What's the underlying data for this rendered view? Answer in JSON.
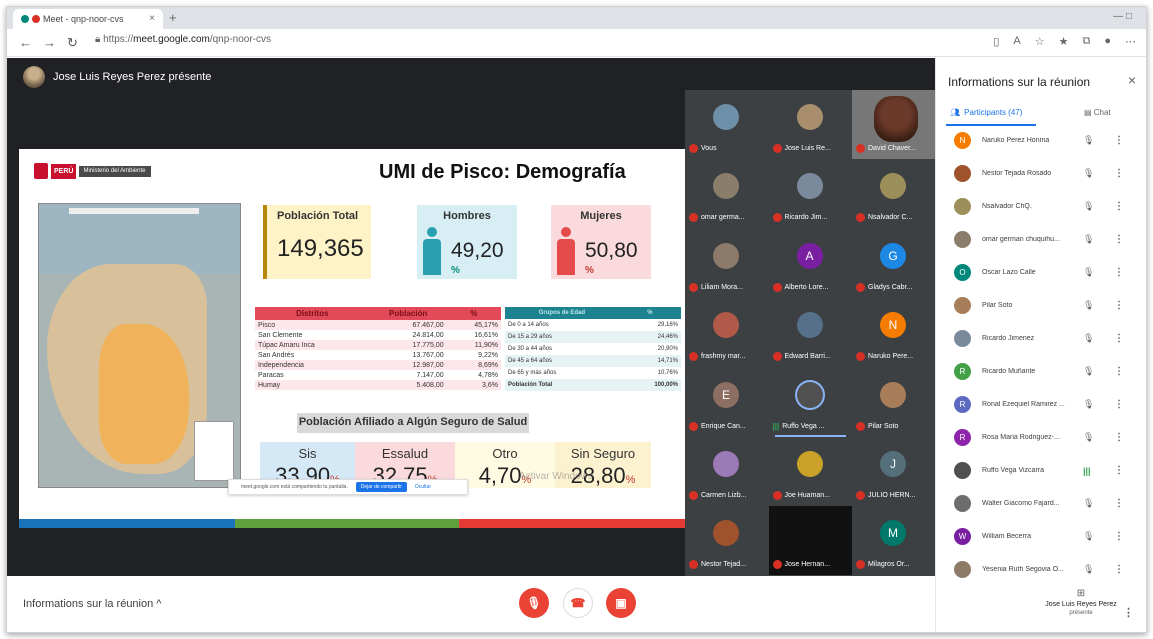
{
  "browser": {
    "tab_title": "Meet - qnp-noor-cvs",
    "tab_close": "×",
    "new_tab": "+",
    "window_controls": "—  □",
    "back": "←",
    "forward": "→",
    "reload": "↻",
    "url_prefix": "https://",
    "url_host": "meet.google.com",
    "url_path": "/qnp-noor-cvs"
  },
  "meet": {
    "presenter_label": "Jose Luis Reyes Perez présente",
    "bottom_info": "Informations sur la réunion ^",
    "controls": {
      "mic": "mic-off",
      "end": "hang-up",
      "cam": "camera-off"
    }
  },
  "slide": {
    "logo_country": "PERÚ",
    "logo_ministry": "Ministerio del Ambiente",
    "title": "UMI de Pisco: Demografía",
    "kpis": {
      "total_label": "Población Total",
      "total_value": "149,365",
      "men_label": "Hombres",
      "men_value": "49,20",
      "men_unit": "%",
      "women_label": "Mujeres",
      "women_value": "50,80",
      "women_unit": "%"
    },
    "districts": {
      "headers": [
        "Distritos",
        "Población",
        "%"
      ],
      "rows": [
        [
          "Pisco",
          "67.467,00",
          "45,17%"
        ],
        [
          "San Clemente",
          "24.814,00",
          "16,61%"
        ],
        [
          "Túpac Amaru Inca",
          "17.775,00",
          "11,90%"
        ],
        [
          "San Andrés",
          "13.767,00",
          "9,22%"
        ],
        [
          "Independencia",
          "12.987,00",
          "8,69%"
        ],
        [
          "Paracas",
          "7.147,00",
          "4,78%"
        ],
        [
          "Humay",
          "5.408,00",
          "3,6%"
        ]
      ]
    },
    "ages": {
      "headers": [
        "Grupos de Edad",
        "%"
      ],
      "rows": [
        [
          "De 0 a 14 años",
          "29,16%"
        ],
        [
          "De 15 a 29 años",
          "24,46%"
        ],
        [
          "De 30 a 44 años",
          "20,90%"
        ],
        [
          "De 45 a 64 años",
          "14,71%"
        ],
        [
          "De 65 y más años",
          "10,76%"
        ],
        [
          "Población Total",
          "100,00%"
        ]
      ]
    },
    "insurance": {
      "title": "Población Afiliado a Algún Seguro de Salud",
      "items": [
        {
          "name": "Sis",
          "value": "33,90",
          "unit": "%"
        },
        {
          "name": "Essalud",
          "value": "32,75",
          "unit": "%"
        },
        {
          "name": "Otro",
          "value": "4,70",
          "unit": "%"
        },
        {
          "name": "Sin Seguro",
          "value": "28,80",
          "unit": "%"
        }
      ]
    },
    "share_bar": {
      "text": "meet.google.com está compartiendo tu pantalla.",
      "stop": "Dejar de compartir",
      "hide": "Ocultar"
    },
    "watermark": "Activar Windows"
  },
  "tiles": [
    {
      "name": "Vous",
      "initial": "",
      "color": "#6d8fa8"
    },
    {
      "name": "Jose Luis Re...",
      "initial": "",
      "color": "#a88e6d"
    },
    {
      "name": "David Chaver...",
      "initial": "",
      "color": ""
    },
    {
      "name": "omar germa...",
      "initial": "",
      "color": "#8a7d6a"
    },
    {
      "name": "Ricardo Jim...",
      "initial": "",
      "color": "#7a8a9c"
    },
    {
      "name": "Nsalvador C...",
      "initial": "",
      "color": "#9c8f5a"
    },
    {
      "name": "Liliam Mora...",
      "initial": "",
      "color": "#8c7a6b"
    },
    {
      "name": "Alberto Lore...",
      "initial": "A",
      "color": "#7b1fa2"
    },
    {
      "name": "Gladys Cabr...",
      "initial": "G",
      "color": "#1e88e5"
    },
    {
      "name": "frashmy mar...",
      "initial": "",
      "color": "#b25a4a"
    },
    {
      "name": "Edward Barri...",
      "initial": "",
      "color": "#56708a"
    },
    {
      "name": "Naruko Pere...",
      "initial": "N",
      "color": "#f57c00"
    },
    {
      "name": "Enrique Can...",
      "initial": "E",
      "color": "#8d6e63"
    },
    {
      "name": "Ruffo Vega ...",
      "initial": "",
      "color": "#505050"
    },
    {
      "name": "Pilar Soto",
      "initial": "",
      "color": "#a87d5a"
    },
    {
      "name": "Carmen Lizb...",
      "initial": "",
      "color": "#9c7ab8"
    },
    {
      "name": "Joe Huaman...",
      "initial": "",
      "color": "#c9a227"
    },
    {
      "name": "JULIO HERN...",
      "initial": "J",
      "color": "#546e7a"
    },
    {
      "name": "Nestor Tejad...",
      "initial": "",
      "color": "#a0522d"
    },
    {
      "name": "Jose Hernan...",
      "initial": "",
      "color": ""
    },
    {
      "name": "Milagros Or...",
      "initial": "M",
      "color": "#00796b"
    }
  ],
  "panel": {
    "title": "Informations sur la réunion",
    "close": "×",
    "participants_tab": "Participants (47)",
    "chat_tab": "Chat",
    "participants": [
      {
        "name": "Naruko Perez Honma",
        "initial": "N",
        "color": "#f57c00",
        "mic": "muted"
      },
      {
        "name": "Nestor Tejada Rosado",
        "initial": "",
        "color": "#a0522d",
        "mic": "muted"
      },
      {
        "name": "Nsalvador ChQ.",
        "initial": "",
        "color": "#9c8f5a",
        "mic": "muted"
      },
      {
        "name": "omar german chuquihu...",
        "initial": "",
        "color": "#8a7d6a",
        "mic": "muted"
      },
      {
        "name": "Oscar Lazo Calle",
        "initial": "O",
        "color": "#00897b",
        "mic": "muted"
      },
      {
        "name": "Pilar Soto",
        "initial": "",
        "color": "#a87d5a",
        "mic": "muted"
      },
      {
        "name": "Ricardo Jimenez",
        "initial": "",
        "color": "#7a8a9c",
        "mic": "muted"
      },
      {
        "name": "Ricardo Muñante",
        "initial": "R",
        "color": "#43a047",
        "mic": "muted"
      },
      {
        "name": "Ronal Ezequiel Ramirez ...",
        "initial": "R",
        "color": "#5c6bc0",
        "mic": "muted"
      },
      {
        "name": "Rosa Maria Rodriguez-...",
        "initial": "R",
        "color": "#8e24aa",
        "mic": "muted"
      },
      {
        "name": "Ruffo Vega Vizcarra",
        "initial": "",
        "color": "#505050",
        "mic": "speaking"
      },
      {
        "name": "Walter Giacomo Fajard...",
        "initial": "",
        "color": "#6d6d6d",
        "mic": "muted"
      },
      {
        "name": "William Becerra",
        "initial": "W",
        "color": "#7b1fa2",
        "mic": "muted"
      },
      {
        "name": "Yesenia Ruth Segovia O...",
        "initial": "",
        "color": "#8d7b68",
        "mic": "muted"
      }
    ],
    "self_name": "Jose Luis Reyes Perez",
    "self_sub": "présente"
  }
}
